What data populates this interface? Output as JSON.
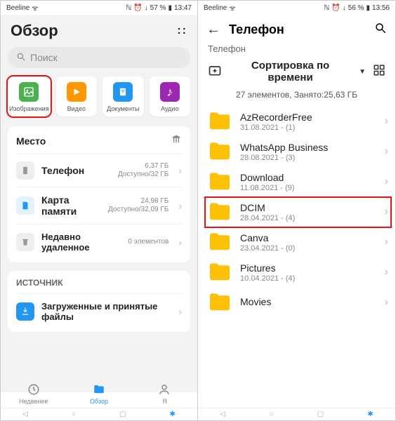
{
  "left": {
    "status": {
      "carrier": "Beeline",
      "battery": "57 %",
      "time": "13:47"
    },
    "title": "Обзор",
    "search": {
      "placeholder": "Поиск"
    },
    "categories": [
      {
        "label": "Изображения",
        "icon": "image-icon",
        "highlighted": true
      },
      {
        "label": "Видео",
        "icon": "video-icon"
      },
      {
        "label": "Документы",
        "icon": "document-icon"
      },
      {
        "label": "Аудио",
        "icon": "audio-icon"
      }
    ],
    "places": {
      "heading": "Место",
      "items": [
        {
          "name": "Телефон",
          "sub": "6,37 ГБ Доступно/32 ГБ"
        },
        {
          "name": "Карта памяти",
          "sub": "24,98 ГБ Доступно/32,09 ГБ"
        },
        {
          "name": "Недавно удаленное",
          "sub": "0 элементов"
        }
      ]
    },
    "source": {
      "heading": "ИСТОЧНИК",
      "items": [
        {
          "name": "Загруженные и принятые файлы"
        }
      ]
    },
    "tabs": [
      {
        "label": "Недавнее"
      },
      {
        "label": "Обзор",
        "active": true
      },
      {
        "label": "Я"
      }
    ]
  },
  "right": {
    "status": {
      "carrier": "Beeline",
      "battery": "56 %",
      "time": "13:56"
    },
    "header": "Телефон",
    "breadcrumb": "Телефон",
    "sort_label": "Сортировка по времени",
    "summary": "27 элементов, Занято:25,63 ГБ",
    "folders": [
      {
        "name": "AzRecorderFree",
        "meta": "31.08.2021 - (1)"
      },
      {
        "name": "WhatsApp Business",
        "meta": "28.08.2021 - (3)"
      },
      {
        "name": "Download",
        "meta": "11.08.2021 - (9)"
      },
      {
        "name": "DCIM",
        "meta": "28.04.2021 - (4)",
        "highlighted": true
      },
      {
        "name": "Canva",
        "meta": "23.04.2021 - (0)"
      },
      {
        "name": "Pictures",
        "meta": "10.04.2021 - (4)"
      },
      {
        "name": "Movies",
        "meta": ""
      }
    ]
  }
}
